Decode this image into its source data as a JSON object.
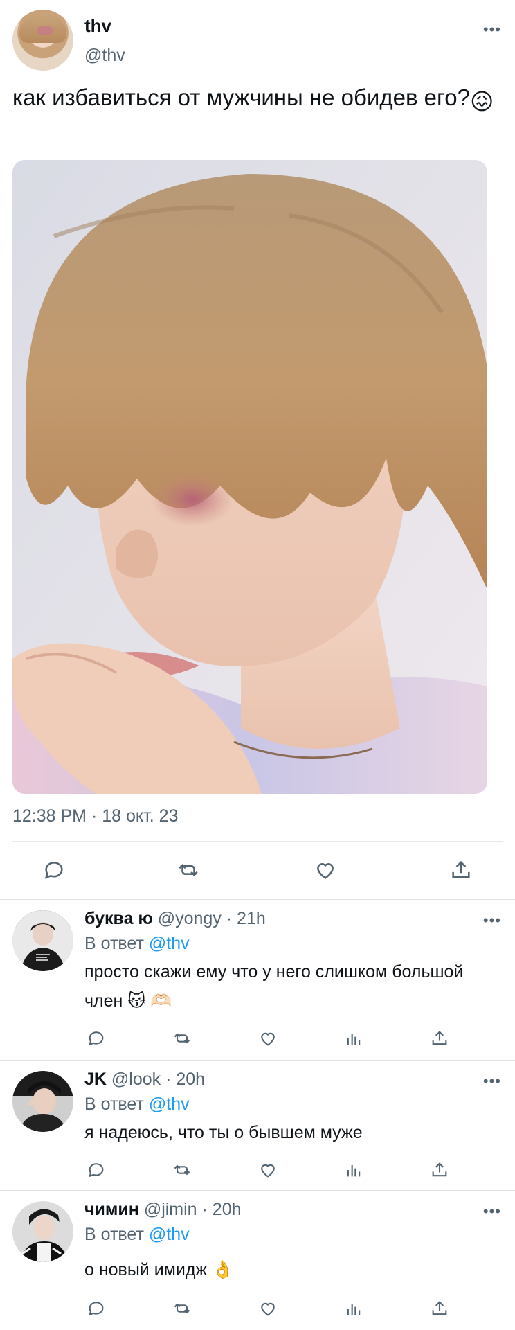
{
  "tweet": {
    "author_name": "thv",
    "author_handle": "@thv",
    "text": "как избавиться от мужчины не обидев его?",
    "text_emoji": "😖",
    "timestamp": "12:38 PM · 18 окт. 23",
    "more_label": "•••"
  },
  "icons": [
    "reply-icon",
    "retweet-icon",
    "like-icon",
    "share-icon",
    "views-icon",
    "more-icon"
  ],
  "colors": {
    "link": "#1d9bf0",
    "secondary": "#536471",
    "primary": "#0f1419",
    "divider": "#e6e9ec"
  },
  "replies": [
    {
      "name": "буква ю",
      "handle_time": "@yongy · 21h",
      "reply_to_prefix": "В ответ",
      "reply_to_handle": "@thv",
      "text": "просто скажи ему что у него слишком большой член 😽 🫶🏻"
    },
    {
      "name": "JK",
      "handle_time": "@look · 20h",
      "reply_to_prefix": "В ответ",
      "reply_to_handle": "@thv",
      "text": "я надеюсь, что ты о бывшем муже"
    },
    {
      "name": "чимин",
      "handle_time": "@jimin · 20h",
      "reply_to_prefix": "В ответ",
      "reply_to_handle": "@thv",
      "text": "о новый имидж 👌"
    }
  ]
}
